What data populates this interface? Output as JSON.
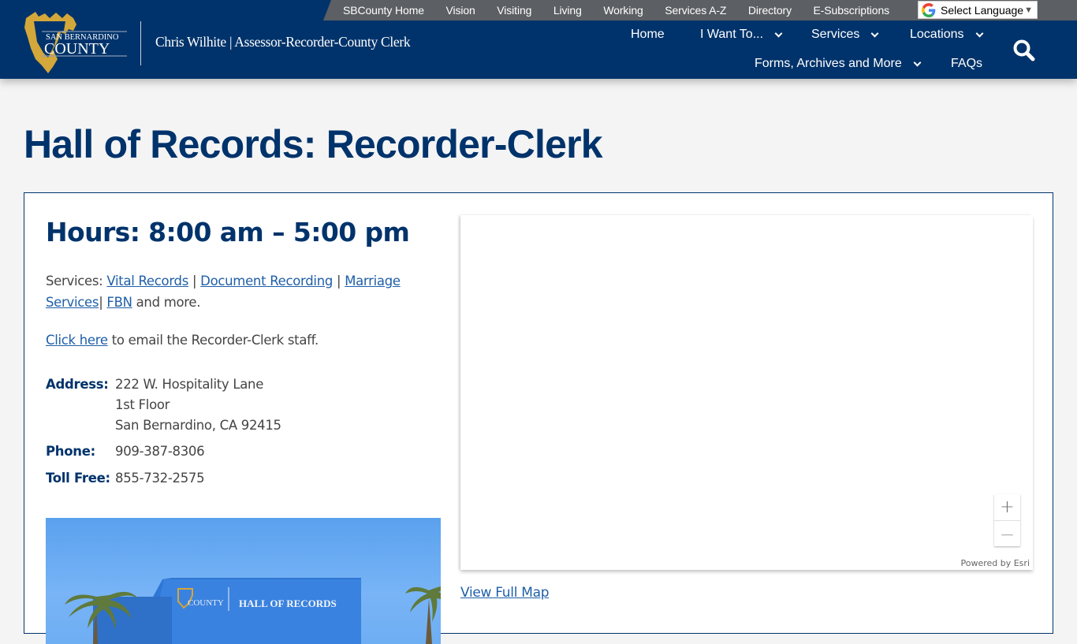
{
  "utility_nav": {
    "links": [
      "SBCounty Home",
      "Vision",
      "Visiting",
      "Living",
      "Working",
      "Services A-Z",
      "Directory",
      "E-Subscriptions"
    ],
    "language_label": "Select Language",
    "language_arrow": "▼"
  },
  "branding": {
    "logo_line1": "SAN BERNARDINO",
    "logo_line2": "COUNTY",
    "department_title": "Chris Wilhite | Assessor-Recorder-County Clerk"
  },
  "main_nav": {
    "row1": [
      {
        "label": "Home",
        "has_dropdown": false
      },
      {
        "label": "I Want To...",
        "has_dropdown": true
      },
      {
        "label": "Services",
        "has_dropdown": true
      },
      {
        "label": "Locations",
        "has_dropdown": true
      }
    ],
    "row2": [
      {
        "label": "Forms, Archives and More",
        "has_dropdown": true
      },
      {
        "label": "FAQs",
        "has_dropdown": false
      }
    ],
    "search_icon": "search-icon"
  },
  "page": {
    "title": "Hall of Records: Recorder-Clerk"
  },
  "location": {
    "hours": "Hours: 8:00 am – 5:00 pm",
    "services_prefix": "Services: ",
    "services_links": [
      "Vital Records",
      "Document Recording",
      "Marriage Services",
      "FBN"
    ],
    "services_suffix": " and more.",
    "email_link": "Click here",
    "email_text": " to email the Recorder-Clerk staff.",
    "address_label": "Address:",
    "address_lines": [
      "222 W. Hospitality Lane",
      "1st Floor",
      "San Bernardino, CA 92415"
    ],
    "phone_label": "Phone:",
    "phone": "909-387-8306",
    "tollfree_label": "Toll Free:",
    "tollfree": "855-732-2575",
    "photo_sign": "HALL OF RECORDS",
    "photo_logo": "COUNTY"
  },
  "map": {
    "zoom_in": "+",
    "zoom_out": "—",
    "attribution": "Powered by Esri",
    "view_full_map": "View Full Map"
  },
  "colors": {
    "brand_navy": "#00336b",
    "utility_gray": "#5c5f63",
    "link_blue": "#1f5fa8",
    "logo_gold": "#d4a73a"
  }
}
